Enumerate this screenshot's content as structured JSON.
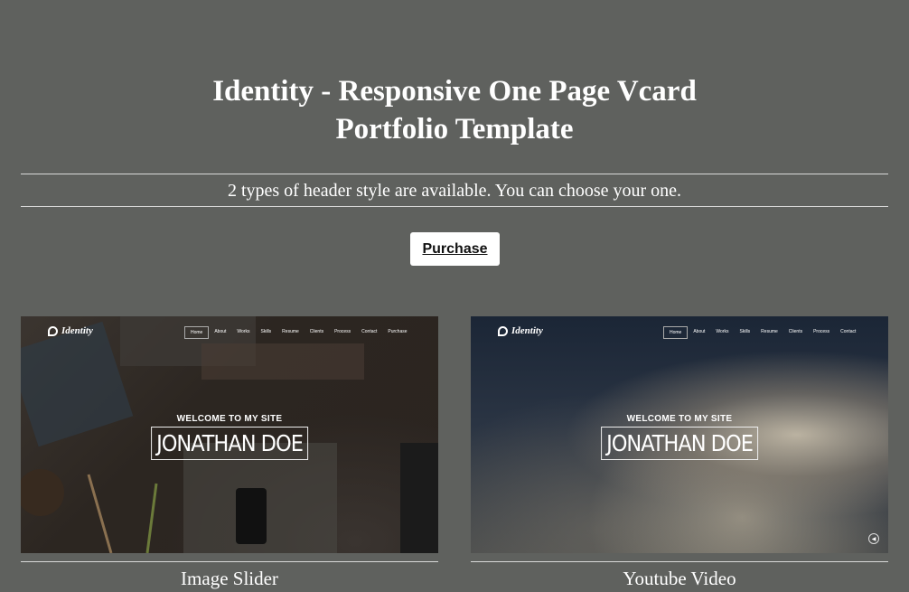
{
  "header": {
    "title_line1": "Identity - Responsive One Page Vcard",
    "title_line2": "Portfolio Template",
    "subtitle": "2 types of header style are available. You can choose your one.",
    "purchase_label": "Purchase"
  },
  "previews": [
    {
      "caption": "Image Slider",
      "logo": "Identity",
      "nav": [
        "Home",
        "About",
        "Works",
        "Skills",
        "Resume",
        "Clients",
        "Process",
        "Contact",
        "Purchase"
      ],
      "welcome": "WELCOME TO MY SITE",
      "name": "JONATHAN DOE"
    },
    {
      "caption": "Youtube Video",
      "logo": "Identity",
      "nav": [
        "Home",
        "About",
        "Works",
        "Skills",
        "Resume",
        "Clients",
        "Process",
        "Contact"
      ],
      "welcome": "WELCOME TO MY SITE",
      "name": "JONATHAN DOE",
      "control_icon": "volume-icon"
    }
  ],
  "colors": {
    "background": "#5f615e",
    "text": "#ffffff",
    "button_bg": "#ffffff"
  }
}
